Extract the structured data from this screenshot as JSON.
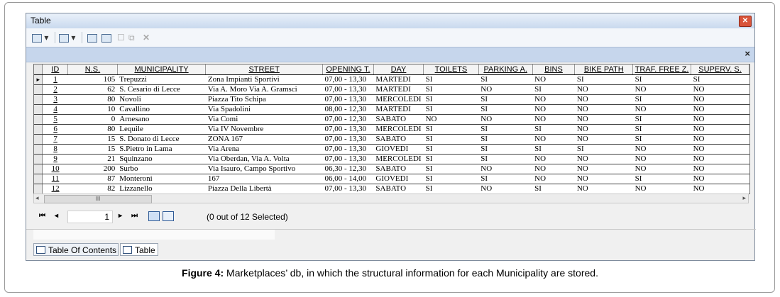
{
  "window": {
    "title": "Table"
  },
  "toolbar": {
    "close_label": "×"
  },
  "table": {
    "columns": [
      "ID",
      "N.S.",
      "MUNICIPALITY",
      "STREET",
      "OPENING T.",
      "DAY",
      "TOILETS",
      "PARKING A.",
      "BINS",
      "BIKE PATH",
      "TRAF. FREE Z.",
      "SUPERV. S."
    ],
    "rows": [
      [
        "1",
        "105",
        "Trepuzzi",
        "Zona Impianti Sportivi",
        "07,00 - 13,30",
        "MARTEDI",
        "SI",
        "SI",
        "NO",
        "SI",
        "SI",
        "SI"
      ],
      [
        "2",
        "62",
        "S. Cesario di Lecce",
        "Via A. Moro  Via A. Gramsci",
        "07,00 - 13,30",
        "MARTEDI",
        "SI",
        "NO",
        "SI",
        "NO",
        "NO",
        "NO"
      ],
      [
        "3",
        "80",
        "Novoli",
        "Piazza Tito Schipa",
        "07,00 - 13,30",
        "MERCOLEDI",
        "SI",
        "SI",
        "NO",
        "NO",
        "SI",
        "NO"
      ],
      [
        "4",
        "10",
        "Cavallino",
        "Via Spadolini",
        "08,00 - 12,30",
        "MARTEDI",
        "SI",
        "SI",
        "NO",
        "NO",
        "NO",
        "NO"
      ],
      [
        "5",
        "0",
        "Arnesano",
        "Via Comi",
        "07,00 - 12,30",
        "SABATO",
        "NO",
        "NO",
        "NO",
        "NO",
        "SI",
        "NO"
      ],
      [
        "6",
        "80",
        "Lequile",
        "Via IV Novembre",
        "07,00 - 13,30",
        "MERCOLEDI",
        "SI",
        "SI",
        "SI",
        "NO",
        "SI",
        "NO"
      ],
      [
        "7",
        "15",
        "S. Donato di Lecce",
        "ZONA 167",
        "07,00 - 13,30",
        "SABATO",
        "SI",
        "SI",
        "NO",
        "NO",
        "SI",
        "NO"
      ],
      [
        "8",
        "15",
        "S.Pietro in Lama",
        "Via Arena",
        "07,00 - 13,30",
        "GIOVEDI",
        "SI",
        "SI",
        "SI",
        "SI",
        "NO",
        "NO"
      ],
      [
        "9",
        "21",
        "Squinzano",
        "Via Oberdan, Via A. Volta",
        "07,00 - 13,30",
        "MERCOLEDI",
        "SI",
        "SI",
        "NO",
        "NO",
        "NO",
        "NO"
      ],
      [
        "10",
        "200",
        "Surbo",
        "Via Isauro, Campo Sportivo",
        "06,30 - 12,30",
        "SABATO",
        "SI",
        "NO",
        "NO",
        "NO",
        "NO",
        "NO"
      ],
      [
        "11",
        "87",
        "Monteroni",
        "167",
        "06,00 - 14,00",
        "GIOVEDI",
        "SI",
        "SI",
        "NO",
        "NO",
        "SI",
        "NO"
      ],
      [
        "12",
        "82",
        "Lizzanello",
        "Piazza Della Libertà",
        "07,00 - 13,30",
        "SABATO",
        "SI",
        "NO",
        "SI",
        "NO",
        "NO",
        "NO"
      ]
    ]
  },
  "scrollbar": {
    "thumb_label": "III"
  },
  "nav": {
    "record": "1",
    "selection": "(0 out of 12 Selected)"
  },
  "tabs": [
    "Table Of Contents",
    "Table"
  ],
  "caption": {
    "label": "Figure 4:",
    "text": " Marketplaces’ db, in which the structural information for each Municipality are stored."
  }
}
